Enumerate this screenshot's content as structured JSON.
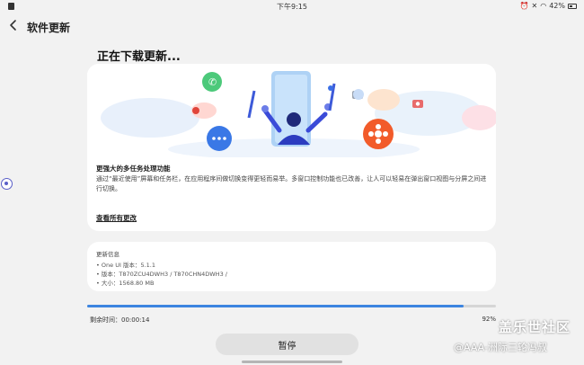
{
  "status_bar": {
    "time": "下午9:15",
    "battery": "42%"
  },
  "header": {
    "title": "软件更新"
  },
  "section": {
    "title": "正在下载更新..."
  },
  "feature": {
    "title": "更强大的多任务处理功能",
    "description": "通过“最近使用”屏幕和任务栏，在应用程序间做切换变得更轻而易举。多窗口控制功能也已改善，让人可以轻易在弹出窗口视图与分屏之间进行切换。",
    "view_all": "查看所有更改"
  },
  "update_info": {
    "title": "更新信息",
    "items": [
      "One UI 版本：5.1.1",
      "版本：T870ZCU4DWH3 / T870CHN4DWH3 /",
      "大小：1568.80 MB"
    ]
  },
  "progress": {
    "remaining_label": "剩余时间：00:00:14",
    "percent_label": "92%",
    "fraction": 0.92,
    "accent": "#3d85e0"
  },
  "pause_button": {
    "label": "暂停"
  },
  "watermark": {
    "line1": "盖乐世社区",
    "line2": "@AAA-洲际三轮冯叔"
  }
}
